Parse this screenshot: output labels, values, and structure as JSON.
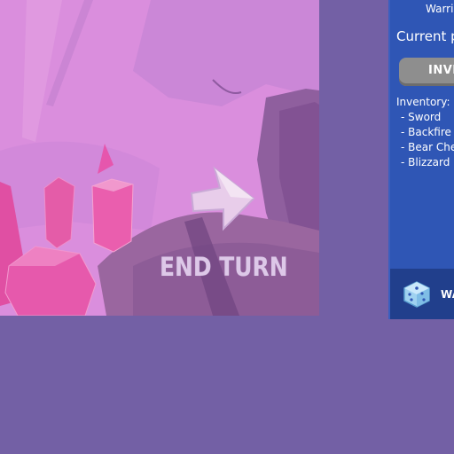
{
  "end_turn": {
    "label": "END TURN"
  },
  "side_panel": {
    "player_name": "Warric",
    "current_player_label": "Current p",
    "inventory_button_label": "INVE",
    "inventory_heading": "Inventory:",
    "inventory_items": [
      "- Sword",
      "- Backfire",
      "- Bear Che",
      "- Blizzard"
    ],
    "footer_label": "WA"
  },
  "icons": [
    "arrow-right-icon",
    "dice-icon"
  ],
  "colors": {
    "background": "#7360a5",
    "scene": "#d98bdc",
    "panel": "#2f56b5",
    "panel_footer": "#213f8c",
    "button_grey": "#8e8e8e",
    "crystal_pink": "#e44fa8"
  }
}
